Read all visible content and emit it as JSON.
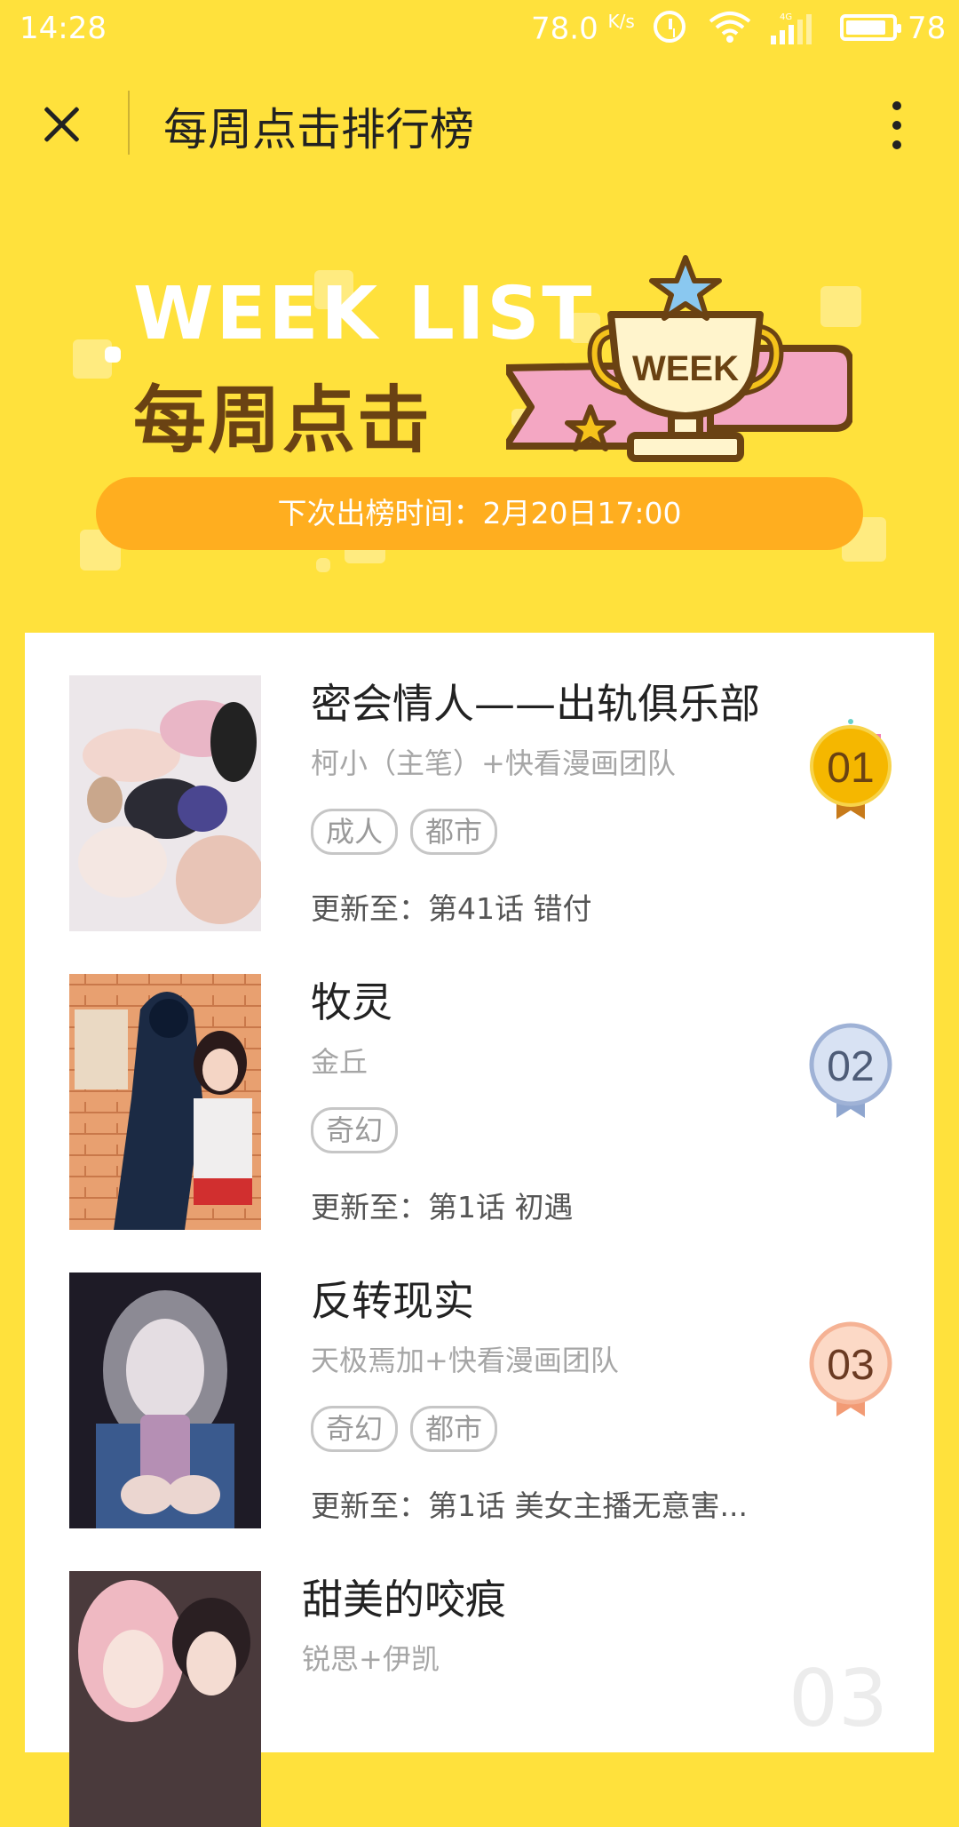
{
  "status_bar": {
    "time": "14:28",
    "net_speed": "78.0",
    "net_unit": "K/s",
    "battery_level": "78"
  },
  "title_bar": {
    "title": "每周点击排行榜"
  },
  "banner": {
    "headline_en": "WEEK LIST",
    "headline_cn": "每周点击",
    "trophy_label": "WEEK",
    "next_release": "下次出榜时间：2月20日17:00"
  },
  "ranking": [
    {
      "rank": "01",
      "title": "密会情人——出轨俱乐部",
      "author": "柯小（主笔）+快看漫画团队",
      "tags": [
        "成人",
        "都市"
      ],
      "update": "更新至：第41话 错付",
      "medal_color": "#F5B700"
    },
    {
      "rank": "02",
      "title": "牧灵",
      "author": "金丘",
      "tags": [
        "奇幻"
      ],
      "update": "更新至：第1话 初遇",
      "medal_color": "#B9C9E8"
    },
    {
      "rank": "03",
      "title": "反转现实",
      "author": "天极焉加+快看漫画团队",
      "tags": [
        "奇幻",
        "都市"
      ],
      "update": "更新至：第1话 美女主播无意害...",
      "medal_color": "#F7B99A"
    },
    {
      "rank": "03",
      "title": "甜美的咬痕",
      "author": "锐思+伊凯",
      "tags": [],
      "update": ""
    }
  ]
}
